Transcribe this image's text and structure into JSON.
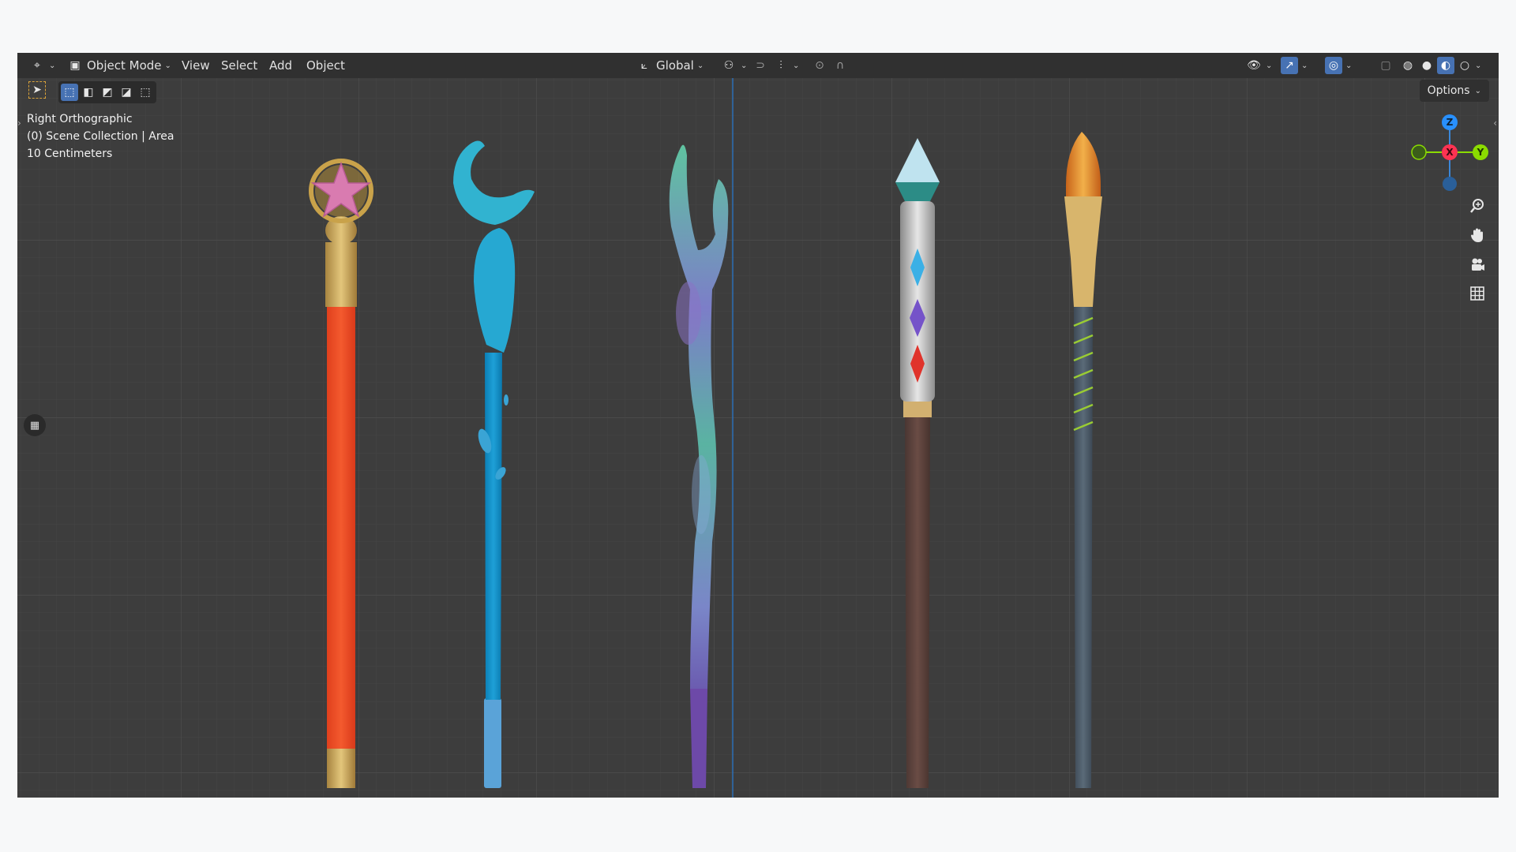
{
  "header": {
    "mode_label": "Object Mode",
    "menus": [
      "View",
      "Select",
      "Add",
      "Object"
    ],
    "orientation_label": "Global",
    "options_label": "Options"
  },
  "overlay": {
    "view_name": "Right Orthographic",
    "collection": "(0) Scene Collection | Area",
    "scale": "10 Centimeters"
  },
  "gizmo": {
    "z": "Z",
    "x": "X",
    "y": "Y"
  },
  "icons": {
    "editor_type": "editor-type-icon",
    "zoom": "zoom-icon",
    "pan": "hand-icon",
    "camera": "camera-icon",
    "grid": "grid-icon"
  },
  "colors": {
    "viewport_bg": "#3d3d3d",
    "accent": "#4772b3",
    "axis_x": "#ff3352",
    "axis_y": "#8bdc00",
    "axis_z": "#2890ff"
  }
}
